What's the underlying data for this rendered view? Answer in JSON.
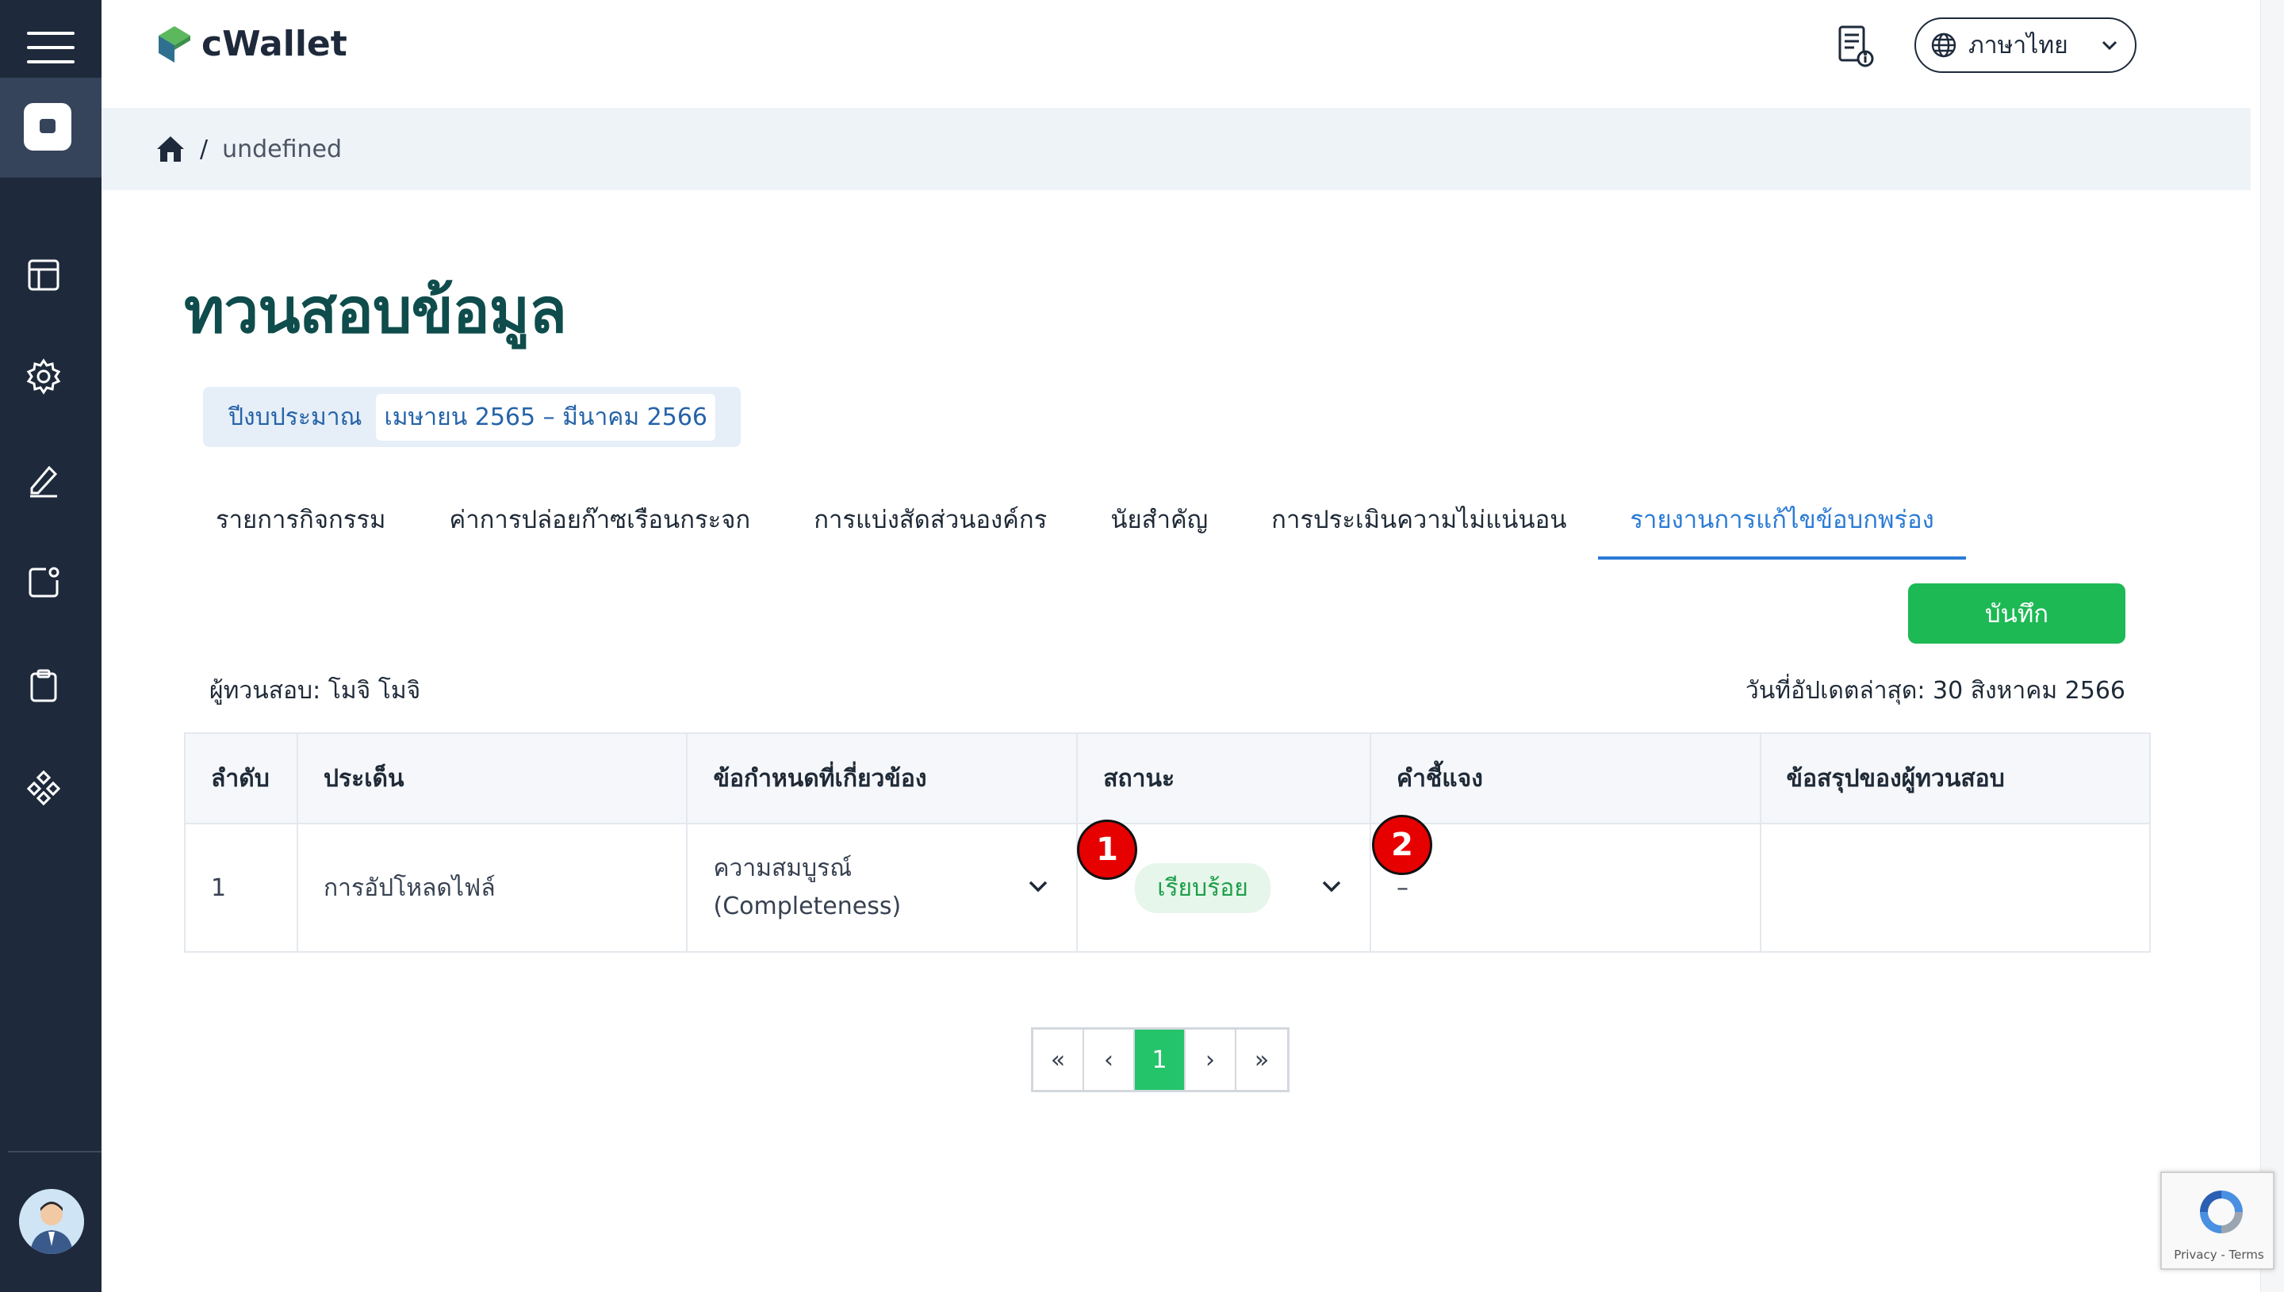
{
  "app": {
    "logo": "cWallet",
    "language": "ภาษาไทย"
  },
  "breadcrumb": {
    "separator": "/",
    "current": "undefined"
  },
  "page": {
    "title": "ทวนสอบข้อมูล",
    "budget_label": "ปีงบประมาณ",
    "budget_value": "เมษายน 2565 – มีนาคม 2566",
    "save_label": "บันทึก",
    "auditor": "ผู้ทวนสอบ: โมจิ โมจิ",
    "updated": "วันที่อัปเดตล่าสุด: 30 สิงหาคม 2566"
  },
  "tabs": [
    {
      "label": "รายการกิจกรรม",
      "active": false
    },
    {
      "label": "ค่าการปล่อยก๊าซเรือนกระจก",
      "active": false
    },
    {
      "label": "การแบ่งสัดส่วนองค์กร",
      "active": false
    },
    {
      "label": "นัยสำคัญ",
      "active": false
    },
    {
      "label": "การประเมินความไม่แน่นอน",
      "active": false
    },
    {
      "label": "รายงานการแก้ไขข้อบกพร่อง",
      "active": true
    }
  ],
  "table": {
    "headers": [
      "ลำดับ",
      "ประเด็น",
      "ข้อกำหนดที่เกี่ยวข้อง",
      "สถานะ",
      "คำชี้แจง",
      "ข้อสรุปของผู้ทวนสอบ"
    ],
    "rows": [
      {
        "no": "1",
        "issue": "การอัปโหลดไฟล์",
        "requirement_line1": "ความสมบูรณ์",
        "requirement_line2": "(Completeness)",
        "status": "เรียบร้อย",
        "explanation": "–",
        "conclusion": ""
      }
    ]
  },
  "markers": {
    "m1": "1",
    "m2": "2"
  },
  "pagination": {
    "first": "«",
    "prev": "‹",
    "current": "1",
    "next": "›",
    "last": "»"
  },
  "recaptcha": {
    "text": "Privacy - Terms"
  },
  "colors": {
    "sidebar": "#1e2a3b",
    "accent_blue": "#2a7bd6",
    "save_green": "#1db954",
    "title_teal": "#0f4c4c",
    "marker_red": "#e60000"
  },
  "icons": [
    "menu-icon",
    "camera-icon",
    "layout-icon",
    "gear-icon",
    "edit-icon",
    "notification-icon",
    "clipboard-icon",
    "diamond-grid-icon",
    "document-info-icon",
    "globe-icon",
    "chevron-down-icon",
    "home-icon",
    "recaptcha-icon"
  ]
}
